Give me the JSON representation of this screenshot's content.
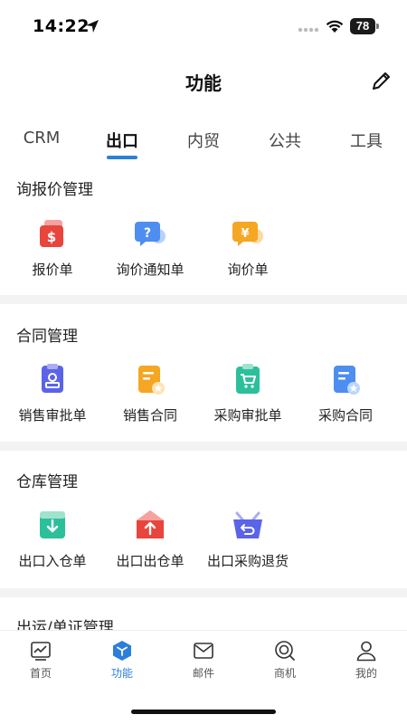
{
  "status_bar": {
    "time": "14:22",
    "battery": "78"
  },
  "header": {
    "title": "功能"
  },
  "tabs": [
    {
      "label": "CRM"
    },
    {
      "label": "出口"
    },
    {
      "label": "内贸"
    },
    {
      "label": "公共"
    },
    {
      "label": "工具"
    }
  ],
  "sections": [
    {
      "title": "询报价管理",
      "items": [
        {
          "label": "报价单"
        },
        {
          "label": "询价通知单"
        },
        {
          "label": "询价单"
        }
      ]
    },
    {
      "title": "合同管理",
      "items": [
        {
          "label": "销售审批单"
        },
        {
          "label": "销售合同"
        },
        {
          "label": "采购审批单"
        },
        {
          "label": "采购合同"
        }
      ]
    },
    {
      "title": "仓库管理",
      "items": [
        {
          "label": "出口入仓单"
        },
        {
          "label": "出口出仓单"
        },
        {
          "label": "出口采购退货"
        }
      ]
    },
    {
      "title": "出运/单证管理"
    }
  ],
  "bottom_nav": [
    {
      "label": "首页"
    },
    {
      "label": "功能"
    },
    {
      "label": "邮件"
    },
    {
      "label": "商机"
    },
    {
      "label": "我的"
    }
  ],
  "colors": {
    "accent": "#2b7fd8",
    "red": "#e8453c",
    "blue": "#4d8ef0",
    "orange": "#f5a623",
    "green": "#2cc09a",
    "purple": "#5b63e8"
  },
  "icons": {
    "quote": "dollar-doc-icon",
    "inquiry_notice": "question-chat-icon",
    "inquiry": "yen-chat-icon",
    "sales_approval": "stamp-icon",
    "sales_contract": "contract-star-icon",
    "purchase_approval": "cart-clipboard-icon",
    "purchase_contract": "contract-star-icon",
    "warehouse_in": "arrow-down-box-icon",
    "warehouse_out": "arrow-up-house-icon",
    "purchase_return": "return-basket-icon"
  }
}
